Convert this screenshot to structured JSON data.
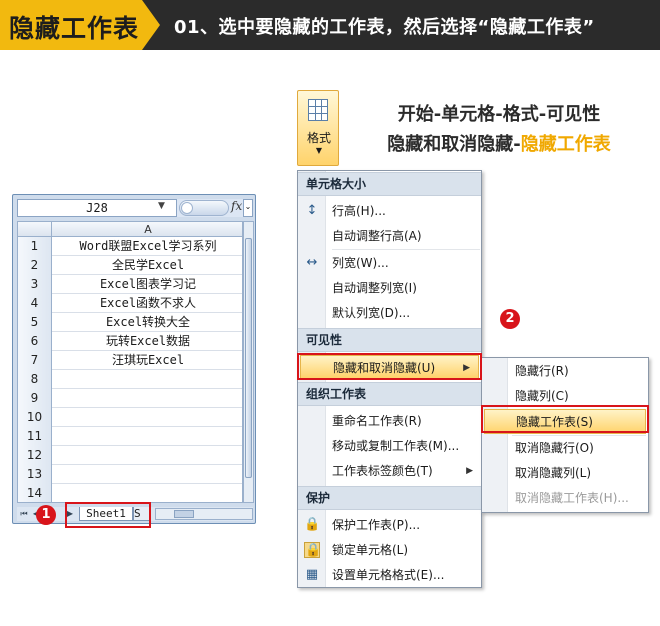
{
  "banner": {
    "tag": "隐藏工作表",
    "text": "01、选中要隐藏的工作表，然后选择“隐藏工作表”"
  },
  "headline": {
    "line1": "开始-单元格-格式-可见性",
    "line2_prefix": "隐藏和取消隐藏-",
    "line2_accent": "隐藏工作表"
  },
  "excel": {
    "name_box": "J28",
    "fx": "fx",
    "column_header": "A",
    "rows": [
      {
        "num": "1",
        "value": "Word联盟Excel学习系列"
      },
      {
        "num": "2",
        "value": "全民学Excel"
      },
      {
        "num": "3",
        "value": "Excel图表学习记"
      },
      {
        "num": "4",
        "value": "Excel函数不求人"
      },
      {
        "num": "5",
        "value": "Excel转换大全"
      },
      {
        "num": "6",
        "value": "玩转Excel数据"
      },
      {
        "num": "7",
        "value": "汪琪玩Excel"
      },
      {
        "num": "8",
        "value": ""
      },
      {
        "num": "9",
        "value": ""
      },
      {
        "num": "10",
        "value": ""
      },
      {
        "num": "11",
        "value": ""
      },
      {
        "num": "12",
        "value": ""
      },
      {
        "num": "13",
        "value": ""
      },
      {
        "num": "14",
        "value": ""
      }
    ],
    "sheet_tab": "Sheet1",
    "sheet_tab2": "S"
  },
  "steps": {
    "one": "1",
    "two": "2"
  },
  "format_button": {
    "label": "格式",
    "caret": "▼"
  },
  "menu": {
    "section_cell_size": "单元格大小",
    "row_height": "行高(H)...",
    "autofit_row": "自动调整行高(A)",
    "col_width": "列宽(W)...",
    "autofit_col": "自动调整列宽(I)",
    "default_width": "默认列宽(D)...",
    "section_visibility": "可见性",
    "hide_unhide": "隐藏和取消隐藏(U)",
    "section_organize": "组织工作表",
    "rename_sheet": "重命名工作表(R)",
    "move_copy": "移动或复制工作表(M)...",
    "tab_color": "工作表标签颜色(T)",
    "section_protect": "保护",
    "protect_sheet": "保护工作表(P)...",
    "lock_cell": "锁定单元格(L)",
    "format_cells": "设置单元格格式(E)..."
  },
  "submenu": {
    "hide_rows": "隐藏行(R)",
    "hide_cols": "隐藏列(C)",
    "hide_sheet": "隐藏工作表(S)",
    "unhide_rows": "取消隐藏行(O)",
    "unhide_cols": "取消隐藏列(L)",
    "unhide_sheet": "取消隐藏工作表(H)..."
  },
  "colors": {
    "accent": "#f2b90f",
    "banner_bg": "#2b2b2b",
    "highlight_red": "#d8141a"
  }
}
